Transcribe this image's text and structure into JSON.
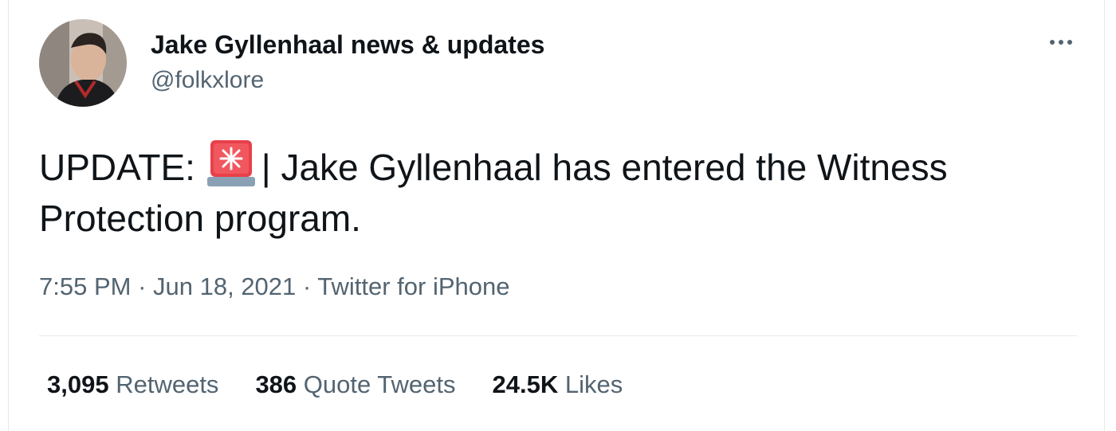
{
  "author": {
    "name": "Jake Gyllenhaal news & updates",
    "handle": "@folkxlore"
  },
  "tweet": {
    "prefix": "UPDATE: ",
    "emoji": "rotating-light-icon",
    "body_line": "| Jake Gyllenhaal has entered the Witness Protection program."
  },
  "meta": {
    "time": "7:55 PM",
    "separator": " · ",
    "date": "Jun 18, 2021",
    "source": "Twitter for iPhone"
  },
  "stats": {
    "retweets": {
      "count": "3,095",
      "label": "Retweets"
    },
    "quotes": {
      "count": "386",
      "label": "Quote Tweets"
    },
    "likes": {
      "count": "24.5K",
      "label": "Likes"
    }
  },
  "colors": {
    "text_primary": "#0f1419",
    "text_secondary": "#536471",
    "divider": "#e6e8ea",
    "emoji_red": "#e8404a"
  }
}
